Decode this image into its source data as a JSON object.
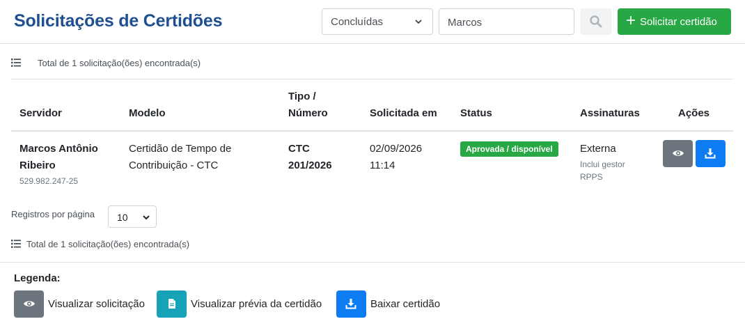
{
  "header": {
    "title": "Solicitações de Certidões",
    "status_filter": "Concluídas",
    "search_value": "Marcos",
    "request_button": "Solicitar certidão"
  },
  "summary": {
    "count_text": "Total de 1 solicitação(ões) encontrada(s)"
  },
  "table": {
    "columns": {
      "servidor": "Servidor",
      "modelo": "Modelo",
      "tipo_line1": "Tipo /",
      "tipo_line2": "Número",
      "solicitada": "Solicitada em",
      "status": "Status",
      "assinaturas": "Assinaturas",
      "acoes": "Ações"
    },
    "rows": [
      {
        "servidor_line1": "Marcos Antônio",
        "servidor_line2": "Ribeiro",
        "cpf": "529.982.247-25",
        "modelo_line1": "Certidão de Tempo de",
        "modelo_line2": "Contribuição - CTC",
        "tipo": "CTC",
        "numero": "201/2026",
        "data": "02/09/2026",
        "hora": "11:14",
        "status": "Aprovada / disponível",
        "assinatura": "Externa",
        "assinatura_note_line1": "Inclui gestor",
        "assinatura_note_line2": "RPPS"
      }
    ]
  },
  "pagination": {
    "per_page_label": "Registros por página",
    "per_page_value": "10"
  },
  "legend": {
    "title": "Legenda:",
    "items": [
      {
        "icon": "eye-icon",
        "label": "Visualizar solicitação"
      },
      {
        "icon": "document-icon",
        "label": "Visualizar prévia da certidão"
      },
      {
        "icon": "download-icon",
        "label": "Baixar certidão"
      }
    ]
  },
  "colors": {
    "title": "#1d4f91",
    "success": "#28a745",
    "primary": "#0d7cf2",
    "secondary": "#6c757d",
    "info": "#17a2b8"
  }
}
